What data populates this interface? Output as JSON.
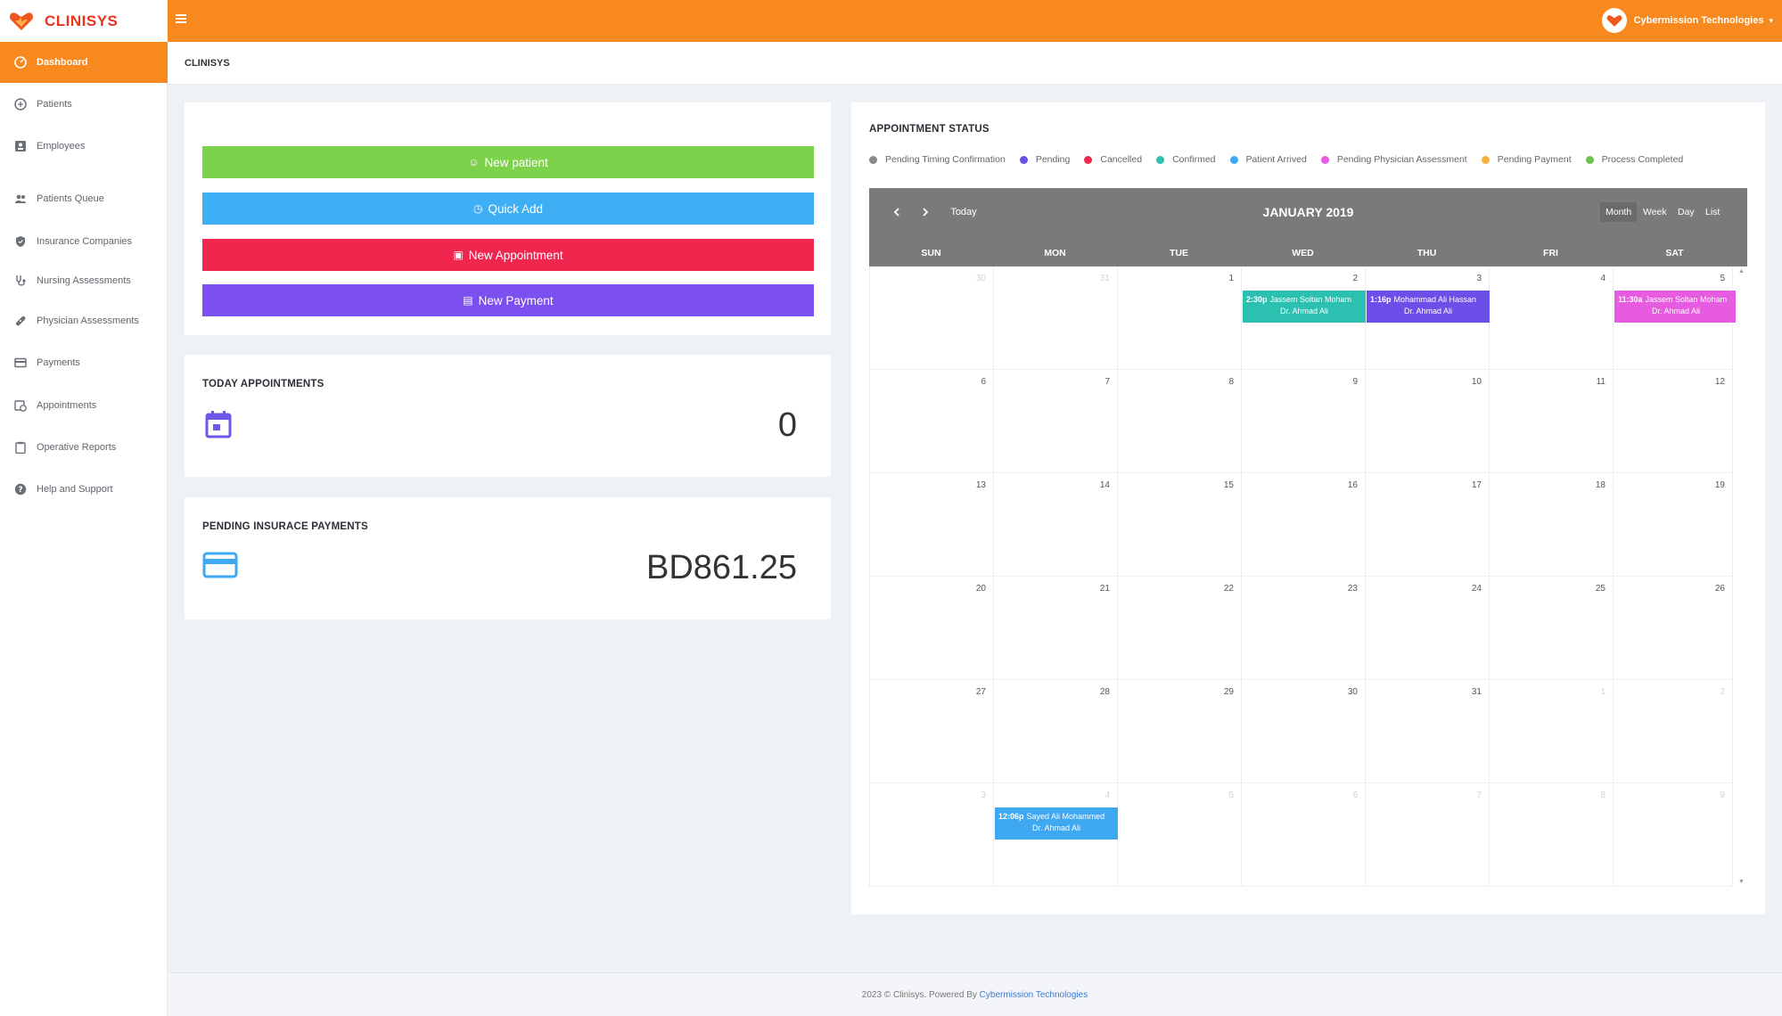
{
  "app": {
    "name": "CLINISYS",
    "brand_color": "#f7891e"
  },
  "user": {
    "name": "Cybermission Technologies"
  },
  "sidebar": {
    "items": [
      {
        "label": "Dashboard",
        "icon": "dashboard-icon"
      },
      {
        "label": "Patients",
        "icon": "patients-icon"
      },
      {
        "label": "Employees",
        "icon": "id-card-icon"
      },
      {
        "label": "Patients Queue",
        "icon": "users-icon"
      },
      {
        "label": "Insurance Companies",
        "icon": "shield-icon"
      },
      {
        "label": "Nursing Assessments",
        "icon": "stethoscope-icon"
      },
      {
        "label": "Physician Assessments",
        "icon": "bandage-icon"
      },
      {
        "label": "Payments",
        "icon": "wallet-icon"
      },
      {
        "label": "Appointments",
        "icon": "calendar-clock-icon"
      },
      {
        "label": "Operative Reports",
        "icon": "clipboard-icon"
      },
      {
        "label": "Help and Support",
        "icon": "question-icon"
      }
    ]
  },
  "breadcrumb": {
    "current": "CLINISYS"
  },
  "actions": {
    "new_patient": {
      "label": "New patient",
      "color": "#7dd24c"
    },
    "quick_add": {
      "label": "Quick Add",
      "color": "#3eaef5"
    },
    "new_appointment": {
      "label": "New Appointment",
      "color": "#f1264f"
    },
    "new_payment": {
      "label": "New Payment",
      "color": "#7b4ff0"
    }
  },
  "today_appointments": {
    "title": "TODAY APPOINTMENTS",
    "value": "0",
    "icon": "calendar-icon"
  },
  "pending_insurance": {
    "title": "PENDING INSURACE PAYMENTS",
    "value": "BD861.25",
    "icon": "credit-card-icon"
  },
  "appointment_status": {
    "title": "APPOINTMENT STATUS",
    "legend": [
      {
        "label": "Pending Timing Confirmation",
        "color": "#8a8a8a"
      },
      {
        "label": "Pending",
        "color": "#6b4fe8"
      },
      {
        "label": "Cancelled",
        "color": "#f1264f"
      },
      {
        "label": "Confirmed",
        "color": "#2bc0b0"
      },
      {
        "label": "Patient Arrived",
        "color": "#3ea8f0"
      },
      {
        "label": "Pending Physician Assessment",
        "color": "#e65be0"
      },
      {
        "label": "Pending Payment",
        "color": "#f5b33e"
      },
      {
        "label": "Process Completed",
        "color": "#6cc24a"
      }
    ]
  },
  "calendar": {
    "title": "JANUARY 2019",
    "today_label": "Today",
    "prev_icon": "chevron-left-icon",
    "next_icon": "chevron-right-icon",
    "views": [
      "Month",
      "Week",
      "Day",
      "List"
    ],
    "active_view": "Month",
    "weekdays": [
      "SUN",
      "MON",
      "TUE",
      "WED",
      "THU",
      "FRI",
      "SAT"
    ],
    "weeks": [
      [
        {
          "d": "30",
          "o": true
        },
        {
          "d": "31",
          "o": true
        },
        {
          "d": "1"
        },
        {
          "d": "2"
        },
        {
          "d": "3"
        },
        {
          "d": "4"
        },
        {
          "d": "5"
        }
      ],
      [
        {
          "d": "6"
        },
        {
          "d": "7"
        },
        {
          "d": "8"
        },
        {
          "d": "9"
        },
        {
          "d": "10"
        },
        {
          "d": "11"
        },
        {
          "d": "12"
        }
      ],
      [
        {
          "d": "13"
        },
        {
          "d": "14"
        },
        {
          "d": "15"
        },
        {
          "d": "16"
        },
        {
          "d": "17"
        },
        {
          "d": "18"
        },
        {
          "d": "19"
        }
      ],
      [
        {
          "d": "20"
        },
        {
          "d": "21"
        },
        {
          "d": "22"
        },
        {
          "d": "23"
        },
        {
          "d": "24"
        },
        {
          "d": "25"
        },
        {
          "d": "26"
        }
      ],
      [
        {
          "d": "27"
        },
        {
          "d": "28"
        },
        {
          "d": "29"
        },
        {
          "d": "30"
        },
        {
          "d": "31"
        },
        {
          "d": "1",
          "o": true
        },
        {
          "d": "2",
          "o": true
        }
      ],
      [
        {
          "d": "3",
          "o": true
        },
        {
          "d": "4",
          "o": true
        },
        {
          "d": "5",
          "o": true
        },
        {
          "d": "6",
          "o": true
        },
        {
          "d": "7",
          "o": true
        },
        {
          "d": "8",
          "o": true
        },
        {
          "d": "9",
          "o": true
        }
      ]
    ],
    "events": [
      {
        "week": 0,
        "day": 3,
        "time": "2:30p",
        "patient": "Jassem Soltan Moham",
        "doctor": "Dr. Ahmad Ali",
        "color": "#2bc0b0"
      },
      {
        "week": 0,
        "day": 4,
        "time": "1:16p",
        "patient": "Mohammad Ali Hassan",
        "doctor": "Dr. Ahmad Ali",
        "color": "#6b4fe8"
      },
      {
        "week": 0,
        "day": 6,
        "time": "11:30a",
        "patient": "Jassem Soltan Moham",
        "doctor": "Dr. Ahmad Ali",
        "color": "#e65be0"
      },
      {
        "week": 5,
        "day": 1,
        "time": "12:06p",
        "patient": "Sayed Ali Mohammed",
        "doctor": "Dr. Ahmad Ali",
        "color": "#3ea8f0"
      }
    ]
  },
  "footer": {
    "text": "2023 © Clinisys. Powered By",
    "link": "Cybermission Technologies"
  }
}
